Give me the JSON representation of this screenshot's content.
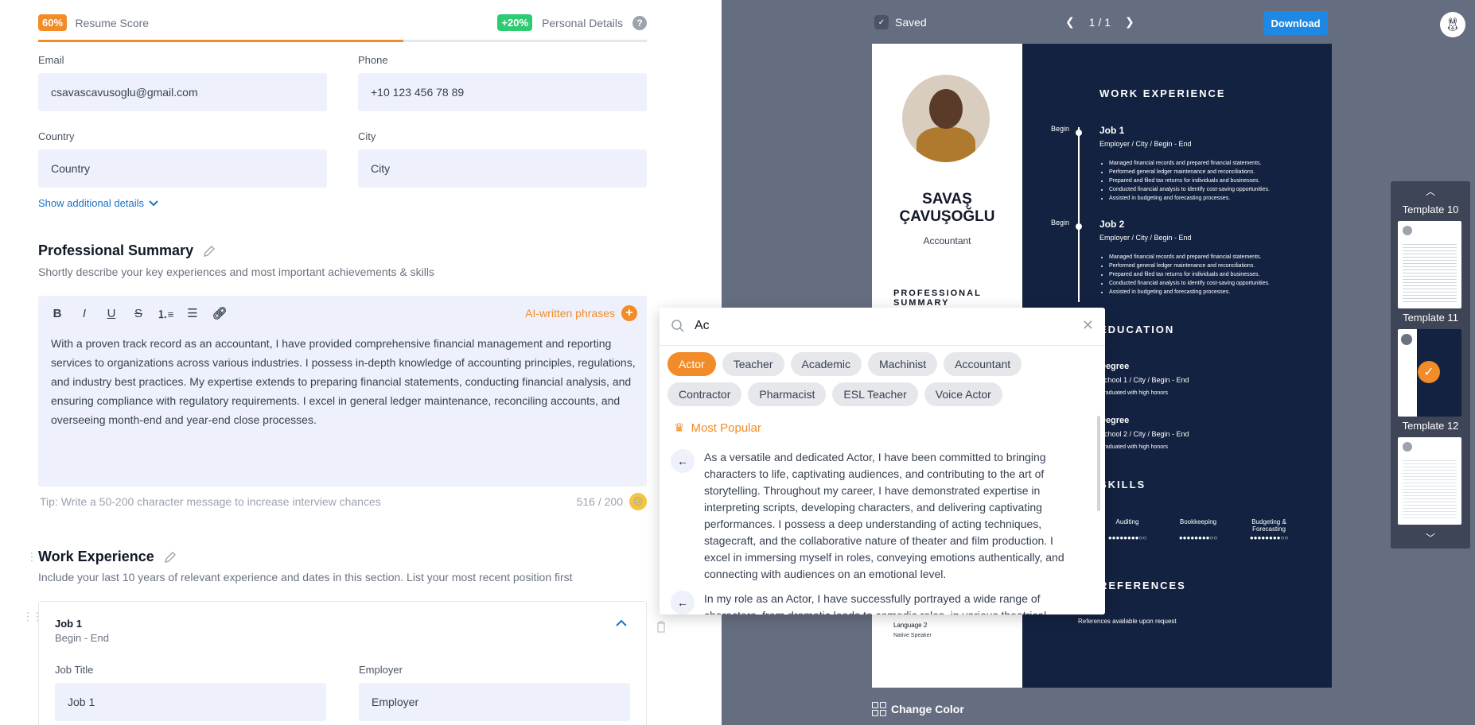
{
  "score": {
    "percent_badge": "60%",
    "label": "Resume Score",
    "progress": 0.6,
    "bonus_badge": "+20%",
    "bonus_label": "Personal Details",
    "help": "?"
  },
  "personal": {
    "email_label": "Email",
    "email_value": "csavascavusoglu@gmail.com",
    "phone_label": "Phone",
    "phone_value": "+10 123 456 78 89",
    "country_label": "Country",
    "country_value": "Country",
    "city_label": "City",
    "city_value": "City",
    "show_more": "Show additional details"
  },
  "summary": {
    "title": "Professional Summary",
    "subtitle": "Shortly describe your key experiences and most important achievements & skills",
    "ai_phrases": "AI-written phrases",
    "text": "With a proven track record as an accountant, I have provided comprehensive financial management and reporting services to organizations across various industries. I possess in-depth knowledge of accounting principles, regulations, and industry best practices. My expertise extends to preparing financial statements, conducting financial analysis, and ensuring compliance with regulatory requirements. I excel in general ledger maintenance, reconciling accounts, and overseeing month-end and year-end close processes.",
    "tip": "Tip: Write a 50-200 character message to increase interview chances",
    "count": "516 / 200"
  },
  "work": {
    "title": "Work Experience",
    "subtitle": "Include your last 10 years of relevant experience and dates in this section. List your most recent position first",
    "job_title": "Job 1",
    "job_dates": "Begin - End",
    "job_title_label": "Job Title",
    "job_title_value": "Job 1",
    "employer_label": "Employer",
    "employer_value": "Employer"
  },
  "preview": {
    "saved": "Saved",
    "page": "1 / 1",
    "download": "Download",
    "change_color": "Change Color"
  },
  "resume": {
    "name_line1": "SAVAŞ",
    "name_line2": "ÇAVUŞOĞLU",
    "role": "Accountant",
    "professional_summary": "PROFESSIONAL SUMMARY",
    "language2": "Language 2",
    "language2_level": "Native Speaker",
    "work_heading": "WORK EXPERIENCE",
    "begin": "Begin",
    "job1": "Job 1",
    "job2": "Job 2",
    "job_sub": "Employer / City / Begin - End",
    "bullets": [
      "Managed financial records and prepared financial statements.",
      "Performed general ledger maintenance and reconciliations.",
      "Prepared and filed tax returns for individuals and businesses.",
      "Conducted financial analysis to identify cost-saving opportunities.",
      "Assisted in budgeting and forecasting processes."
    ],
    "education_heading": "EDUCATION",
    "degree": "Degree",
    "school1": "School 1 / City / Begin - End",
    "school2": "School 2 / City / Begin - End",
    "honors": "Graduated with high honors",
    "skills_heading": "SKILLS",
    "skill1": "Auditing",
    "skill2": "Bookkeeping",
    "skill3": "Budgeting & Forecasting",
    "skill_dots": "●●●●●●●●○○",
    "references_heading": "REFERENCES",
    "references_text": "References available upon request"
  },
  "templates": {
    "t10": "Template 10",
    "t11": "Template 11",
    "t12": "Template 12"
  },
  "popup": {
    "query": "Ac",
    "chips": [
      "Actor",
      "Teacher",
      "Academic",
      "Machinist",
      "Accountant",
      "Contractor",
      "Pharmacist",
      "ESL Teacher",
      "Voice Actor"
    ],
    "most_popular": "Most Popular",
    "suggestion1": "As a versatile and dedicated Actor, I have been committed to bringing characters to life, captivating audiences, and contributing to the art of storytelling. Throughout my career, I have demonstrated expertise in interpreting scripts, developing characters, and delivering captivating performances. I possess a deep understanding of acting techniques, stagecraft, and the collaborative nature of theater and film production. I excel in immersing myself in roles, conveying emotions authentically, and connecting with audiences on an emotional level.",
    "suggestion2": "In my role as an Actor, I have successfully portrayed a wide range of characters, from dramatic leads to comedic roles, in various theatrical"
  },
  "colors": {
    "accent": "#f28c28",
    "primary": "#1e88e5",
    "resume_dark": "#132240",
    "preview_bg": "#656d80"
  }
}
